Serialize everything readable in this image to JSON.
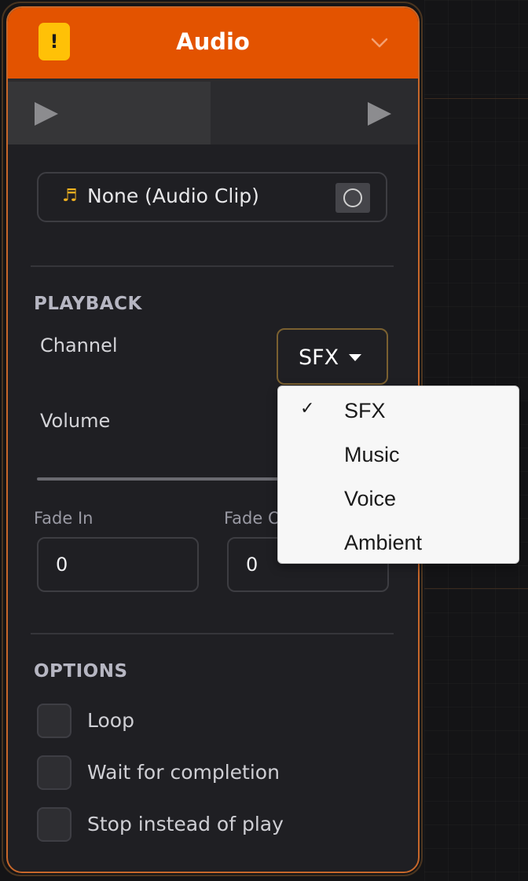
{
  "header": {
    "title": "Audio",
    "warning_icon": "exclamation-badge",
    "warning_glyph": "!",
    "accent_color": "#e35300"
  },
  "clip": {
    "icon": "music-note-icon",
    "icon_glyph": "♬",
    "label": "None (Audio Clip)"
  },
  "playback": {
    "section_title": "PLAYBACK",
    "channel_label": "Channel",
    "channel_value": "SFX",
    "volume_label": "Volume",
    "fade_in_label": "Fade In",
    "fade_in_value": "0",
    "fade_out_value": "0"
  },
  "dropdown": {
    "check_glyph": "✓",
    "options": [
      {
        "label": "SFX",
        "selected": true
      },
      {
        "label": "Music",
        "selected": false
      },
      {
        "label": "Voice",
        "selected": false
      },
      {
        "label": "Ambient",
        "selected": false
      }
    ]
  },
  "options": {
    "section_title": "OPTIONS",
    "items": [
      {
        "label": "Loop",
        "checked": false
      },
      {
        "label": "Wait for completion",
        "checked": false
      },
      {
        "label": "Stop instead of play",
        "checked": false
      }
    ]
  }
}
